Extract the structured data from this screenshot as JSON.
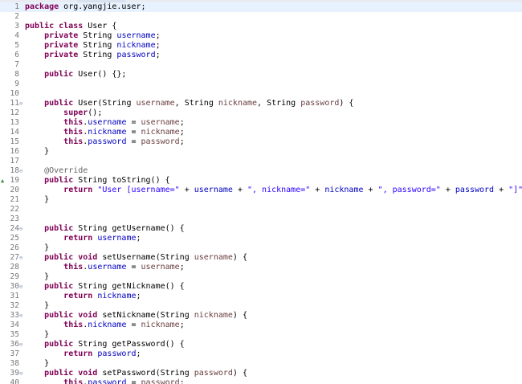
{
  "editor": {
    "lines": [
      {
        "n": "1",
        "fold": "",
        "tokens": [
          [
            "kw",
            "package"
          ],
          [
            "pl",
            " org.yangjie.user;"
          ]
        ]
      },
      {
        "n": "2",
        "fold": "",
        "tokens": []
      },
      {
        "n": "3",
        "fold": "",
        "tokens": [
          [
            "kw",
            "public class"
          ],
          [
            "pl",
            " User {"
          ]
        ]
      },
      {
        "n": "4",
        "fold": "",
        "tokens": [
          [
            "pl",
            "    "
          ],
          [
            "kw",
            "private"
          ],
          [
            "pl",
            " String "
          ],
          [
            "fld",
            "username"
          ],
          [
            "pl",
            ";"
          ]
        ]
      },
      {
        "n": "5",
        "fold": "",
        "tokens": [
          [
            "pl",
            "    "
          ],
          [
            "kw",
            "private"
          ],
          [
            "pl",
            " String "
          ],
          [
            "fld",
            "nickname"
          ],
          [
            "pl",
            ";"
          ]
        ]
      },
      {
        "n": "6",
        "fold": "",
        "tokens": [
          [
            "pl",
            "    "
          ],
          [
            "kw",
            "private"
          ],
          [
            "pl",
            " String "
          ],
          [
            "fld",
            "password"
          ],
          [
            "pl",
            ";"
          ]
        ]
      },
      {
        "n": "7",
        "fold": "",
        "tokens": []
      },
      {
        "n": "8",
        "fold": "",
        "tokens": [
          [
            "pl",
            "    "
          ],
          [
            "kw",
            "public"
          ],
          [
            "pl",
            " User() {};"
          ]
        ]
      },
      {
        "n": "9",
        "fold": "",
        "tokens": []
      },
      {
        "n": "10",
        "fold": "",
        "tokens": []
      },
      {
        "n": "11",
        "fold": "⊖",
        "tokens": [
          [
            "pl",
            "    "
          ],
          [
            "kw",
            "public"
          ],
          [
            "pl",
            " User(String "
          ],
          [
            "prm",
            "username"
          ],
          [
            "pl",
            ", String "
          ],
          [
            "prm",
            "nickname"
          ],
          [
            "pl",
            ", String "
          ],
          [
            "prm",
            "password"
          ],
          [
            "pl",
            ") {"
          ]
        ]
      },
      {
        "n": "12",
        "fold": "",
        "tokens": [
          [
            "pl",
            "        "
          ],
          [
            "kw",
            "super"
          ],
          [
            "pl",
            "();"
          ]
        ]
      },
      {
        "n": "13",
        "fold": "",
        "tokens": [
          [
            "pl",
            "        "
          ],
          [
            "kw",
            "this"
          ],
          [
            "pl",
            "."
          ],
          [
            "fld",
            "username"
          ],
          [
            "pl",
            " = "
          ],
          [
            "prm",
            "username"
          ],
          [
            "pl",
            ";"
          ]
        ]
      },
      {
        "n": "14",
        "fold": "",
        "tokens": [
          [
            "pl",
            "        "
          ],
          [
            "kw",
            "this"
          ],
          [
            "pl",
            "."
          ],
          [
            "fld",
            "nickname"
          ],
          [
            "pl",
            " = "
          ],
          [
            "prm",
            "nickname"
          ],
          [
            "pl",
            ";"
          ]
        ]
      },
      {
        "n": "15",
        "fold": "",
        "tokens": [
          [
            "pl",
            "        "
          ],
          [
            "kw",
            "this"
          ],
          [
            "pl",
            "."
          ],
          [
            "fld",
            "password"
          ],
          [
            "pl",
            " = "
          ],
          [
            "prm",
            "password"
          ],
          [
            "pl",
            ";"
          ]
        ]
      },
      {
        "n": "16",
        "fold": "",
        "tokens": [
          [
            "pl",
            "    }"
          ]
        ]
      },
      {
        "n": "17",
        "fold": "",
        "tokens": []
      },
      {
        "n": "18",
        "fold": "⊖",
        "tokens": [
          [
            "pl",
            "    "
          ],
          [
            "ann",
            "@Override"
          ]
        ]
      },
      {
        "n": "19",
        "fold": "",
        "override": "▲",
        "tokens": [
          [
            "pl",
            "    "
          ],
          [
            "kw",
            "public"
          ],
          [
            "pl",
            " String toString() {"
          ]
        ]
      },
      {
        "n": "20",
        "fold": "",
        "tokens": [
          [
            "pl",
            "        "
          ],
          [
            "kw",
            "return"
          ],
          [
            "pl",
            " "
          ],
          [
            "str",
            "\"User [username=\""
          ],
          [
            "pl",
            " + "
          ],
          [
            "fld",
            "username"
          ],
          [
            "pl",
            " + "
          ],
          [
            "str",
            "\", nickname=\""
          ],
          [
            "pl",
            " + "
          ],
          [
            "fld",
            "nickname"
          ],
          [
            "pl",
            " + "
          ],
          [
            "str",
            "\", password=\""
          ],
          [
            "pl",
            " + "
          ],
          [
            "fld",
            "password"
          ],
          [
            "pl",
            " + "
          ],
          [
            "str",
            "\"]\""
          ],
          [
            "pl",
            ";"
          ]
        ]
      },
      {
        "n": "21",
        "fold": "",
        "tokens": [
          [
            "pl",
            "    }"
          ]
        ]
      },
      {
        "n": "22",
        "fold": "",
        "tokens": []
      },
      {
        "n": "23",
        "fold": "",
        "tokens": []
      },
      {
        "n": "24",
        "fold": "⊖",
        "tokens": [
          [
            "pl",
            "    "
          ],
          [
            "kw",
            "public"
          ],
          [
            "pl",
            " String getUsername() {"
          ]
        ]
      },
      {
        "n": "25",
        "fold": "",
        "tokens": [
          [
            "pl",
            "        "
          ],
          [
            "kw",
            "return"
          ],
          [
            "pl",
            " "
          ],
          [
            "fld",
            "username"
          ],
          [
            "pl",
            ";"
          ]
        ]
      },
      {
        "n": "26",
        "fold": "",
        "tokens": [
          [
            "pl",
            "    }"
          ]
        ]
      },
      {
        "n": "27",
        "fold": "⊖",
        "tokens": [
          [
            "pl",
            "    "
          ],
          [
            "kw",
            "public void"
          ],
          [
            "pl",
            " setUsername(String "
          ],
          [
            "prm",
            "username"
          ],
          [
            "pl",
            ") {"
          ]
        ]
      },
      {
        "n": "28",
        "fold": "",
        "tokens": [
          [
            "pl",
            "        "
          ],
          [
            "kw",
            "this"
          ],
          [
            "pl",
            "."
          ],
          [
            "fld",
            "username"
          ],
          [
            "pl",
            " = "
          ],
          [
            "prm",
            "username"
          ],
          [
            "pl",
            ";"
          ]
        ]
      },
      {
        "n": "29",
        "fold": "",
        "tokens": [
          [
            "pl",
            "    }"
          ]
        ]
      },
      {
        "n": "30",
        "fold": "⊖",
        "tokens": [
          [
            "pl",
            "    "
          ],
          [
            "kw",
            "public"
          ],
          [
            "pl",
            " String getNickname() {"
          ]
        ]
      },
      {
        "n": "31",
        "fold": "",
        "tokens": [
          [
            "pl",
            "        "
          ],
          [
            "kw",
            "return"
          ],
          [
            "pl",
            " "
          ],
          [
            "fld",
            "nickname"
          ],
          [
            "pl",
            ";"
          ]
        ]
      },
      {
        "n": "32",
        "fold": "",
        "tokens": [
          [
            "pl",
            "    }"
          ]
        ]
      },
      {
        "n": "33",
        "fold": "⊖",
        "tokens": [
          [
            "pl",
            "    "
          ],
          [
            "kw",
            "public void"
          ],
          [
            "pl",
            " setNickname(String "
          ],
          [
            "prm",
            "nickname"
          ],
          [
            "pl",
            ") {"
          ]
        ]
      },
      {
        "n": "34",
        "fold": "",
        "tokens": [
          [
            "pl",
            "        "
          ],
          [
            "kw",
            "this"
          ],
          [
            "pl",
            "."
          ],
          [
            "fld",
            "nickname"
          ],
          [
            "pl",
            " = "
          ],
          [
            "prm",
            "nickname"
          ],
          [
            "pl",
            ";"
          ]
        ]
      },
      {
        "n": "35",
        "fold": "",
        "tokens": [
          [
            "pl",
            "    }"
          ]
        ]
      },
      {
        "n": "36",
        "fold": "⊖",
        "tokens": [
          [
            "pl",
            "    "
          ],
          [
            "kw",
            "public"
          ],
          [
            "pl",
            " String getPassword() {"
          ]
        ]
      },
      {
        "n": "37",
        "fold": "",
        "tokens": [
          [
            "pl",
            "        "
          ],
          [
            "kw",
            "return"
          ],
          [
            "pl",
            " "
          ],
          [
            "fld",
            "password"
          ],
          [
            "pl",
            ";"
          ]
        ]
      },
      {
        "n": "38",
        "fold": "",
        "tokens": [
          [
            "pl",
            "    }"
          ]
        ]
      },
      {
        "n": "39",
        "fold": "⊖",
        "tokens": [
          [
            "pl",
            "    "
          ],
          [
            "kw",
            "public void"
          ],
          [
            "pl",
            " setPassword(String "
          ],
          [
            "prm",
            "password"
          ],
          [
            "pl",
            ") {"
          ]
        ]
      },
      {
        "n": "40",
        "fold": "",
        "tokens": [
          [
            "pl",
            "        "
          ],
          [
            "kw",
            "this"
          ],
          [
            "pl",
            "."
          ],
          [
            "fld",
            "password"
          ],
          [
            "pl",
            " = "
          ],
          [
            "prm",
            "password"
          ],
          [
            "pl",
            ";"
          ]
        ]
      }
    ],
    "current_line": "1"
  },
  "colors": {
    "keyword": "#7f0055",
    "field": "#0000c0",
    "parameter": "#6a3e3e",
    "string": "#2a00ff",
    "annotation": "#646464",
    "current_line_bg": "#e8f2fe",
    "line_number": "#787878"
  },
  "icons": {
    "fold": "fold-collapse-icon",
    "override": "override-marker-icon"
  }
}
